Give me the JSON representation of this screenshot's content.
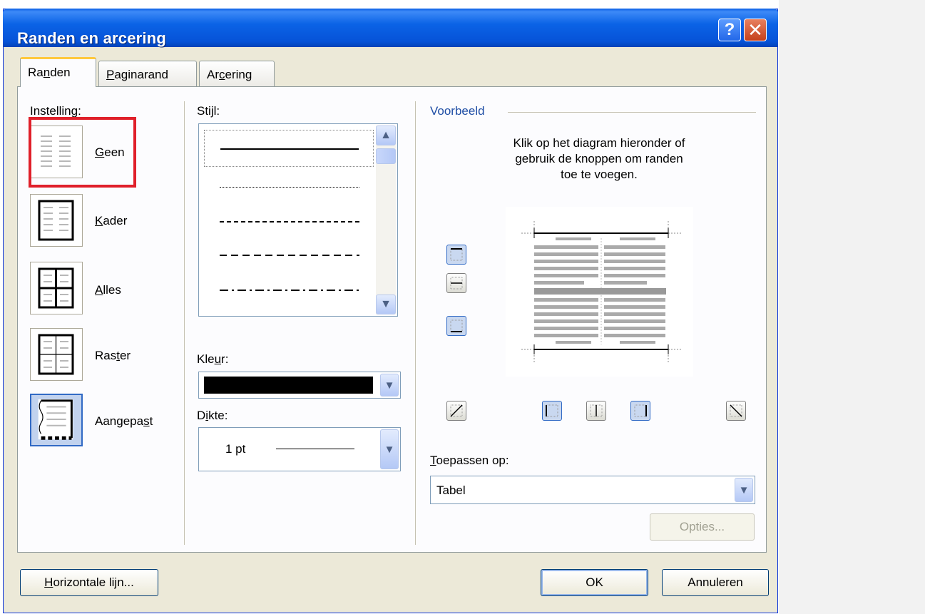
{
  "window": {
    "title": "Randen en arcering",
    "help_label": "?",
    "close_label": "✕"
  },
  "tabs": [
    {
      "label_pre": "Ra",
      "label_u": "n",
      "label_post": "den",
      "active": true
    },
    {
      "label_pre": "",
      "label_u": "P",
      "label_post": "aginarand",
      "active": false
    },
    {
      "label_pre": "Ar",
      "label_u": "c",
      "label_post": "ering",
      "active": false
    }
  ],
  "settings": {
    "heading": "Instelling:",
    "items": [
      {
        "pre": "",
        "u": "G",
        "post": "een",
        "selected": false
      },
      {
        "pre": "",
        "u": "K",
        "post": "ader",
        "selected": false
      },
      {
        "pre": "",
        "u": "A",
        "post": "lles",
        "selected": false
      },
      {
        "pre": "Ras",
        "u": "t",
        "post": "er",
        "selected": false
      },
      {
        "pre": "Aangepa",
        "u": "s",
        "post": "t",
        "selected": true
      }
    ]
  },
  "style": {
    "label_pre": "Sti",
    "label_u": "j",
    "label_post": "l:",
    "lines": [
      "solid",
      "dotted",
      "dashed-small",
      "dashed",
      "dashdot"
    ]
  },
  "color": {
    "label_pre": "Kle",
    "label_u": "u",
    "label_post": "r:",
    "value": "#000000"
  },
  "width": {
    "label_pre": "D",
    "label_u": "i",
    "label_post": "kte:",
    "value": "1 pt"
  },
  "preview": {
    "heading": "Voorbeeld",
    "instructions_1": "Klik op het diagram hieronder of",
    "instructions_2": "gebruik de knoppen om randen",
    "instructions_3": "toe te voegen."
  },
  "apply_to": {
    "label_pre": "",
    "label_u": "T",
    "label_post": "oepassen op:",
    "value": "Tabel"
  },
  "buttons": {
    "options": "Opties...",
    "horizontal_line_u": "H",
    "horizontal_line_post": "orizontale lijn...",
    "ok": "OK",
    "cancel": "Annuleren"
  },
  "colors": {
    "title_bar": "#0b63e6",
    "dialog_bg": "#ece9d8",
    "highlight_box": "#e0202a",
    "heading_blue": "#1f4ea5"
  }
}
